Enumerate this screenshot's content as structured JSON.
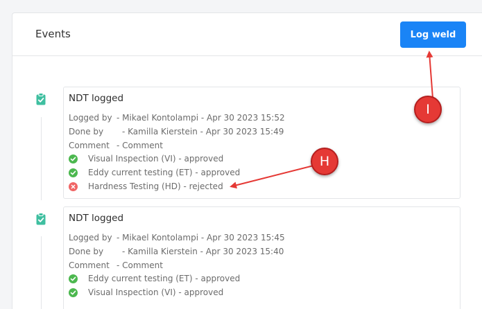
{
  "header": {
    "title": "Events",
    "log_button": "Log weld"
  },
  "events": [
    {
      "title": "NDT logged",
      "logged_by_label": "Logged by",
      "logged_by": "- Mikael Kontolampi - Apr 30 2023 15:52",
      "done_by_label": "Done by",
      "done_by": "- Kamilla Kierstein - Apr 30 2023 15:49",
      "comment_label": "Comment",
      "comment": "- Comment",
      "results": [
        {
          "text": "Visual Inspection (VI) - approved",
          "status": "approved"
        },
        {
          "text": "Eddy current testing (ET) - approved",
          "status": "approved"
        },
        {
          "text": "Hardness Testing (HD) - rejected",
          "status": "rejected"
        }
      ]
    },
    {
      "title": "NDT logged",
      "logged_by_label": "Logged by",
      "logged_by": "- Mikael Kontolampi - Apr 30 2023 15:45",
      "done_by_label": "Done by",
      "done_by": "- Kamilla Kierstein - Apr 30 2023 15:40",
      "comment_label": "Comment",
      "comment": "- Comment",
      "results": [
        {
          "text": "Eddy current testing (ET) - approved",
          "status": "approved"
        },
        {
          "text": "Visual Inspection (VI) - approved",
          "status": "approved"
        }
      ]
    }
  ],
  "markers": {
    "h": "H",
    "i": "I"
  },
  "colors": {
    "accent": "#1a84f6",
    "approved": "#4cb84f",
    "rejected": "#f06565",
    "icon": "#3fbfa0",
    "marker": "#e53935"
  }
}
